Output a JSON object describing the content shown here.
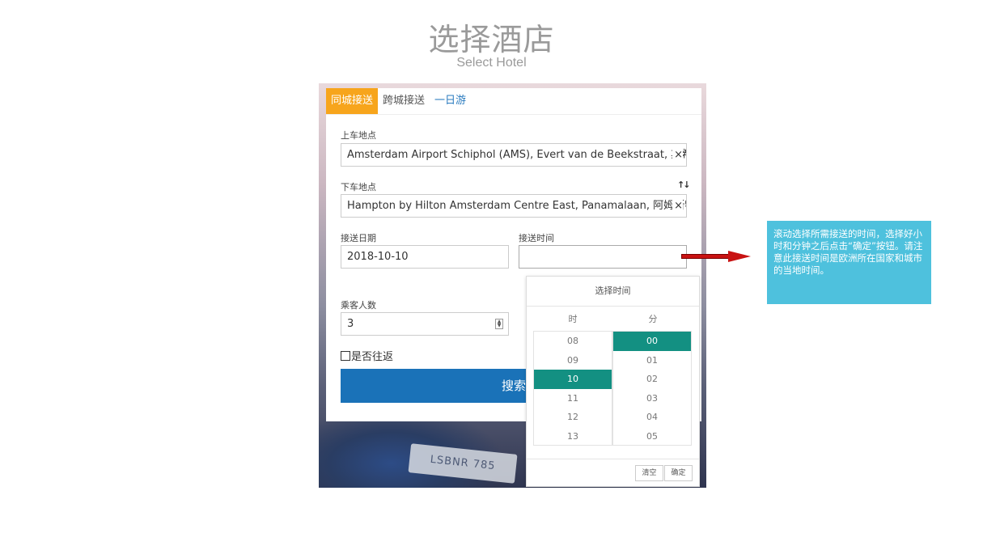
{
  "slide": {
    "title": "选择酒店",
    "subtitle": "Select Hotel"
  },
  "tabs": [
    {
      "label": "同城接送",
      "active": true
    },
    {
      "label": "跨城接送",
      "active": false
    },
    {
      "label": "一日游",
      "active": false
    }
  ],
  "form": {
    "pickup_label": "上车地点",
    "pickup_value": "Amsterdam Airport Schiphol (AMS), Evert van de Beekstraat, 斯希普霍尔",
    "dropoff_label": "下车地点",
    "dropoff_value": "Hampton by Hilton Amsterdam Centre East, Panamalaan, 阿姆斯特丹荷兰",
    "date_label": "接送日期",
    "date_value": "2018-10-10",
    "time_label": "接送时间",
    "time_value": "",
    "passengers_label": "乘客人数",
    "passengers_value": "3",
    "roundtrip_label": "是否往返",
    "search_label": "搜索",
    "clear_glyph": "×",
    "swap_glyph": "↑↓"
  },
  "background": {
    "plate_text": "LSBNR 785"
  },
  "time_picker": {
    "title": "选择时间",
    "hour_header": "时",
    "minute_header": "分",
    "hours": [
      "08",
      "09",
      "10",
      "11",
      "12",
      "13"
    ],
    "minutes": [
      "00",
      "01",
      "02",
      "03",
      "04",
      "05"
    ],
    "selected_hour": "10",
    "selected_minute": "00",
    "clear_label": "清空",
    "confirm_label": "确定"
  },
  "annotation": {
    "text": "滚动选择所需接送的时间，选择好小时和分钟之后点击“确定”按钮。请注意此接送时间是欧洲所在国家和城市的当地时间。"
  },
  "colors": {
    "accent_tab": "#f7a51c",
    "button": "#1a72b8",
    "selected": "#139082",
    "tooltip": "#4ec1dd",
    "arrow": "#c81212"
  }
}
